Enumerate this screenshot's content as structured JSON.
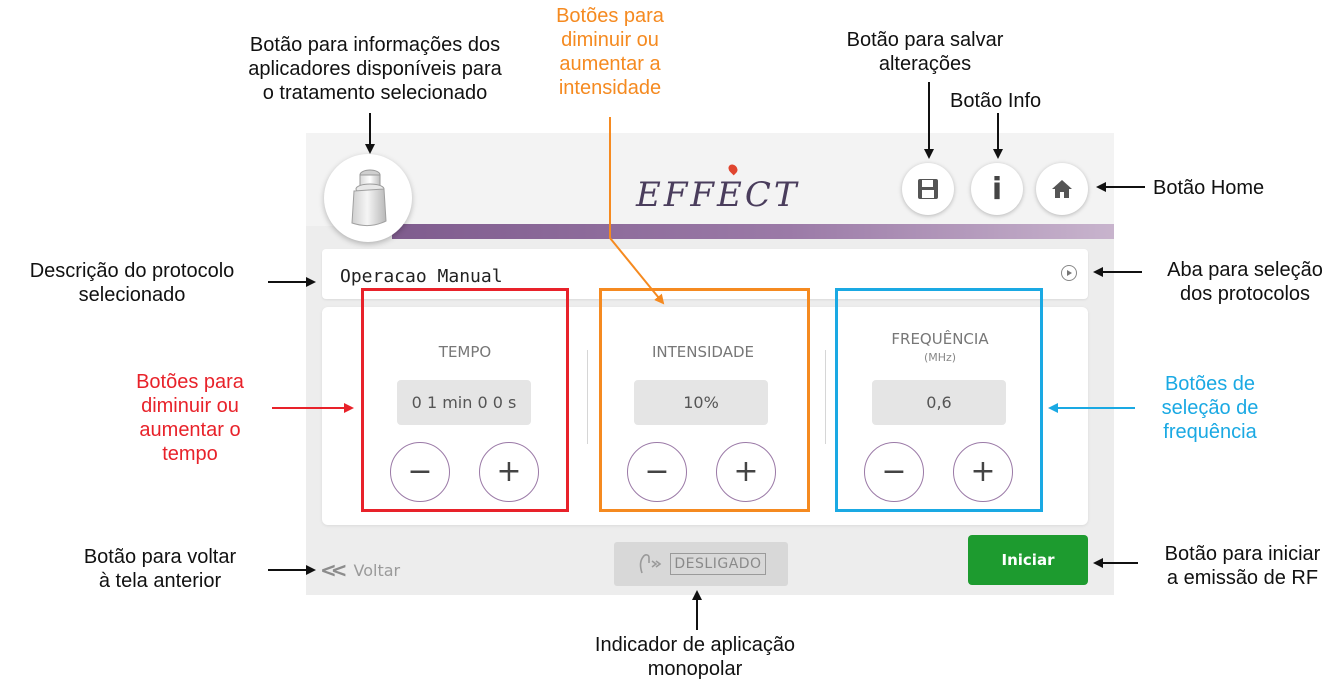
{
  "app": {
    "logo": "EFFECT",
    "protocol_description": "Operacao Manual",
    "controls": [
      {
        "key": "tempo",
        "label": "TEMPO",
        "unit": "",
        "value": "0 1 min 0 0 s",
        "minus": "−",
        "plus": "+"
      },
      {
        "key": "intensidade",
        "label": "INTENSIDADE",
        "unit": "",
        "value": "10%",
        "minus": "−",
        "plus": "+"
      },
      {
        "key": "frequencia",
        "label": "FREQUÊNCIA",
        "unit": "(MHz)",
        "value": "0,6",
        "minus": "−",
        "plus": "+"
      }
    ],
    "info_button": "i",
    "back_label": "Voltar",
    "monopolar_status": "DESLIGADO",
    "start_label": "Iniciar",
    "colors": {
      "accent": "#9b7aa7",
      "start": "#1d9b2f",
      "tempo_frame": "#e8222a",
      "intensity_frame": "#f58a20",
      "frequency_frame": "#1aa9e3"
    },
    "icons": [
      "applicator-icon",
      "save-icon",
      "info-icon",
      "home-icon",
      "play-icon",
      "back-icon",
      "monopolar-icon"
    ]
  },
  "annotations": {
    "applicators": [
      "Botão para informações dos",
      "aplicadores disponíveis para",
      "o tratamento selecionado"
    ],
    "intensity": [
      "Botões para",
      "diminuir ou",
      "aumentar a",
      "intensidade"
    ],
    "save": [
      "Botão para salvar",
      "alterações"
    ],
    "info": "Botão Info",
    "home": "Botão Home",
    "protocol_desc": [
      "Descrição do protocolo",
      "selecionado"
    ],
    "protocol_tab": [
      "Aba para seleção",
      "dos protocolos"
    ],
    "tempo": [
      "Botões para",
      "diminuir ou",
      "aumentar o",
      "tempo"
    ],
    "frequency": [
      "Botões de",
      "seleção de",
      "frequência"
    ],
    "back": [
      "Botão para voltar",
      "à tela anterior"
    ],
    "start": [
      "Botão para iniciar",
      "a emissão de RF"
    ],
    "monopolar": [
      "Indicador de aplicação",
      "monopolar"
    ]
  }
}
